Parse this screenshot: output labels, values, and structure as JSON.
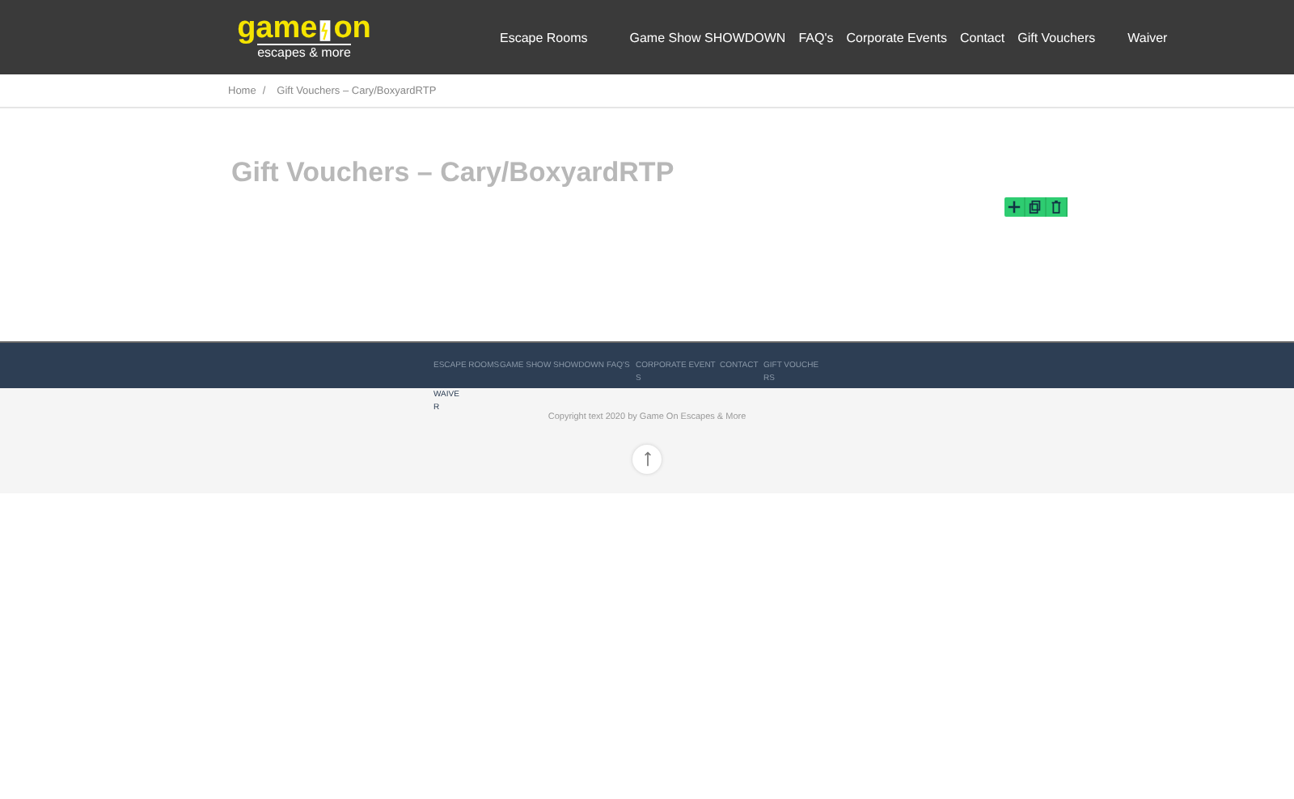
{
  "logo": {
    "word_1": "game",
    "word_2": "on",
    "tagline": "escapes & more"
  },
  "nav": [
    {
      "label": "Escape Rooms"
    },
    {
      "label": "Game Show SHOWDOWN"
    },
    {
      "label": "FAQ's"
    },
    {
      "label": "Corporate Events"
    },
    {
      "label": "Contact"
    },
    {
      "label": "Gift Vouchers"
    },
    {
      "label": "Waiver"
    }
  ],
  "breadcrumb": {
    "home": "Home",
    "separator": "/",
    "current": "Gift Vouchers – Cary/BoxyardRTP"
  },
  "page_title": "Gift Vouchers – Cary/BoxyardRTP",
  "footer_nav": [
    {
      "label": "ESCAPE ROOMS"
    },
    {
      "label": "GAME SHOW SHOWDOWN"
    },
    {
      "label": "FAQ'S"
    },
    {
      "label": "CORPORATE EVENTS"
    },
    {
      "label": "CONTACT"
    },
    {
      "label": "GIFT VOUCHERS"
    },
    {
      "label": "WAIVER"
    }
  ],
  "copyright": "Copyright text 2020 by Game On Escapes & More"
}
